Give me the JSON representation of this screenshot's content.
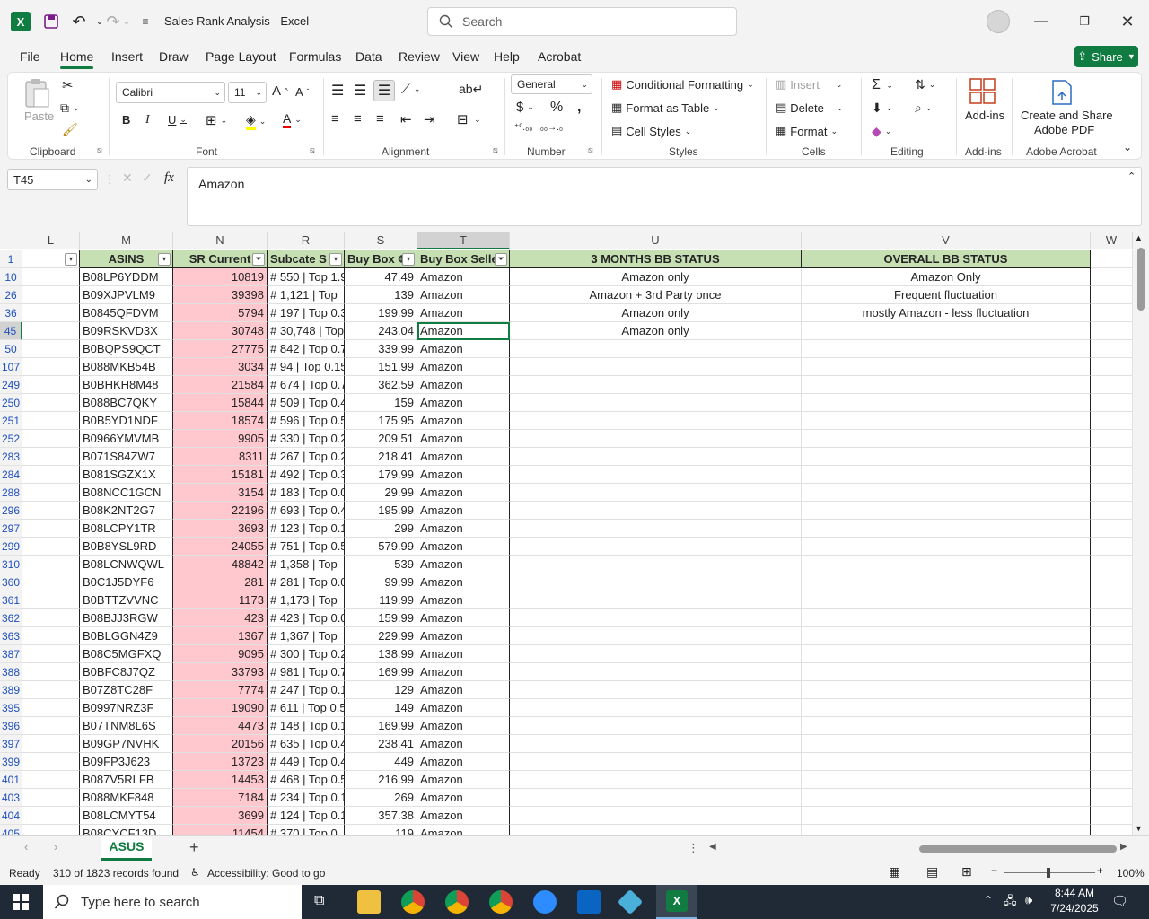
{
  "app": {
    "title": "Sales Rank Analysis  -  Excel",
    "search_placeholder": "Search"
  },
  "menu": [
    "File",
    "Home",
    "Insert",
    "Draw",
    "Page Layout",
    "Formulas",
    "Data",
    "Review",
    "View",
    "Help",
    "Acrobat"
  ],
  "share_label": "Share",
  "ribbon": {
    "clipboard": {
      "paste": "Paste",
      "label": "Clipboard"
    },
    "font": {
      "name": "Calibri",
      "size": "11",
      "label": "Font"
    },
    "alignment": {
      "label": "Alignment"
    },
    "number": {
      "format": "General",
      "label": "Number"
    },
    "styles": {
      "cond": "Conditional Formatting",
      "table": "Format as Table",
      "cell": "Cell Styles",
      "label": "Styles"
    },
    "cells": {
      "insert": "Insert",
      "delete": "Delete",
      "format": "Format",
      "label": "Cells"
    },
    "editing": {
      "label": "Editing"
    },
    "addins": {
      "btn": "Add-ins",
      "label": "Add-ins"
    },
    "acrobat": {
      "btn1": "Create and Share",
      "btn2": "Adobe PDF",
      "label": "Adobe Acrobat"
    }
  },
  "formula": {
    "namebox": "T45",
    "fx": "fx",
    "value": "Amazon"
  },
  "columns": [
    "L",
    "M",
    "N",
    "R",
    "S",
    "T",
    "U",
    "V",
    "W"
  ],
  "headers": {
    "asins": "ASINS",
    "sr_current": "SR Current",
    "subcate": "Subcate S",
    "buybox": "Buy Box ¢",
    "buybox_seller": "Buy Box Selle",
    "three_months": "3 MONTHS BB STATUS",
    "overall": "OVERALL BB STATUS"
  },
  "rows": [
    {
      "r": "1"
    },
    {
      "r": "10",
      "asin": "B08LP6YDDM",
      "sr": "10819",
      "sub": "# 550 | Top 1.9",
      "bb": "47.49",
      "seller": "Amazon",
      "u": "Amazon only",
      "v": "Amazon Only"
    },
    {
      "r": "26",
      "asin": "B09XJPVLM9",
      "sr": "39398",
      "sub": "# 1,121 | Top",
      "bb": "139",
      "seller": "Amazon",
      "u": "Amazon + 3rd Party once",
      "v": "Frequent fluctuation"
    },
    {
      "r": "36",
      "asin": "B0845QFDVM",
      "sr": "5794",
      "sub": "# 197 | Top 0.3",
      "bb": "199.99",
      "seller": "Amazon",
      "u": "Amazon only",
      "v": "mostly Amazon - less fluctuation"
    },
    {
      "r": "45",
      "asin": "B09RSKVD3X",
      "sr": "30748",
      "sub": "# 30,748 | Top",
      "bb": "243.04",
      "seller": "Amazon",
      "u": "Amazon only",
      "v": ""
    },
    {
      "r": "50",
      "asin": "B0BQPS9QCT",
      "sr": "27775",
      "sub": "# 842 | Top 0.7",
      "bb": "339.99",
      "seller": "Amazon"
    },
    {
      "r": "107",
      "asin": "B088MKB54B",
      "sr": "3034",
      "sub": "# 94 | Top 0.15",
      "bb": "151.99",
      "seller": "Amazon"
    },
    {
      "r": "249",
      "asin": "B0BHKH8M48",
      "sr": "21584",
      "sub": "# 674 | Top 0.7",
      "bb": "362.59",
      "seller": "Amazon"
    },
    {
      "r": "250",
      "asin": "B088BC7QKY",
      "sr": "15844",
      "sub": "# 509 | Top 0.4",
      "bb": "159",
      "seller": "Amazon"
    },
    {
      "r": "251",
      "asin": "B0B5YD1NDF",
      "sr": "18574",
      "sub": "# 596 | Top 0.5",
      "bb": "175.95",
      "seller": "Amazon"
    },
    {
      "r": "252",
      "asin": "B0966YMVMB",
      "sr": "9905",
      "sub": "# 330 | Top 0.2",
      "bb": "209.51",
      "seller": "Amazon"
    },
    {
      "r": "283",
      "asin": "B071S84ZW7",
      "sr": "8311",
      "sub": "# 267 | Top 0.2",
      "bb": "218.41",
      "seller": "Amazon"
    },
    {
      "r": "284",
      "asin": "B081SGZX1X",
      "sr": "15181",
      "sub": "# 492 | Top 0.3",
      "bb": "179.99",
      "seller": "Amazon"
    },
    {
      "r": "288",
      "asin": "B08NCC1GCN",
      "sr": "3154",
      "sub": "# 183 | Top 0.0",
      "bb": "29.99",
      "seller": "Amazon"
    },
    {
      "r": "296",
      "asin": "B08K2NT2G7",
      "sr": "22196",
      "sub": "# 693 | Top 0.4",
      "bb": "195.99",
      "seller": "Amazon"
    },
    {
      "r": "297",
      "asin": "B08LCPY1TR",
      "sr": "3693",
      "sub": "# 123 | Top 0.1",
      "bb": "299",
      "seller": "Amazon"
    },
    {
      "r": "299",
      "asin": "B0B8YSL9RD",
      "sr": "24055",
      "sub": "# 751 | Top 0.5",
      "bb": "579.99",
      "seller": "Amazon"
    },
    {
      "r": "310",
      "asin": "B08LCNWQWL",
      "sr": "48842",
      "sub": "# 1,358 | Top",
      "bb": "539",
      "seller": "Amazon"
    },
    {
      "r": "360",
      "asin": "B0C1J5DYF6",
      "sr": "281",
      "sub": "# 281 | Top 0.0",
      "bb": "99.99",
      "seller": "Amazon"
    },
    {
      "r": "361",
      "asin": "B0BTTZVVNC",
      "sr": "1173",
      "sub": "# 1,173 | Top",
      "bb": "119.99",
      "seller": "Amazon"
    },
    {
      "r": "362",
      "asin": "B08BJJ3RGW",
      "sr": "423",
      "sub": "# 423 | Top 0.0",
      "bb": "159.99",
      "seller": "Amazon"
    },
    {
      "r": "363",
      "asin": "B0BLGGN4Z9",
      "sr": "1367",
      "sub": "# 1,367 | Top",
      "bb": "229.99",
      "seller": "Amazon"
    },
    {
      "r": "387",
      "asin": "B08C5MGFXQ",
      "sr": "9095",
      "sub": "# 300 | Top 0.2",
      "bb": "138.99",
      "seller": "Amazon"
    },
    {
      "r": "388",
      "asin": "B0BFC8J7QZ",
      "sr": "33793",
      "sub": "# 981 | Top 0.7",
      "bb": "169.99",
      "seller": "Amazon"
    },
    {
      "r": "389",
      "asin": "B07Z8TC28F",
      "sr": "7774",
      "sub": "# 247 | Top 0.1",
      "bb": "129",
      "seller": "Amazon"
    },
    {
      "r": "395",
      "asin": "B0997NRZ3F",
      "sr": "19090",
      "sub": "# 611 | Top 0.5",
      "bb": "149",
      "seller": "Amazon"
    },
    {
      "r": "396",
      "asin": "B07TNM8L6S",
      "sr": "4473",
      "sub": "# 148 | Top 0.1",
      "bb": "169.99",
      "seller": "Amazon"
    },
    {
      "r": "397",
      "asin": "B09GP7NVHK",
      "sr": "20156",
      "sub": "# 635 | Top 0.4",
      "bb": "238.41",
      "seller": "Amazon"
    },
    {
      "r": "399",
      "asin": "B09FP3J623",
      "sr": "13723",
      "sub": "# 449 | Top 0.4",
      "bb": "449",
      "seller": "Amazon"
    },
    {
      "r": "401",
      "asin": "B087V5RLFB",
      "sr": "14453",
      "sub": "# 468 | Top 0.5",
      "bb": "216.99",
      "seller": "Amazon"
    },
    {
      "r": "403",
      "asin": "B088MKF848",
      "sr": "7184",
      "sub": "# 234 | Top 0.1",
      "bb": "269",
      "seller": "Amazon"
    },
    {
      "r": "404",
      "asin": "B08LCMYT54",
      "sr": "3699",
      "sub": "# 124 | Top 0.1",
      "bb": "357.38",
      "seller": "Amazon"
    },
    {
      "r": "405",
      "asin": "B08CYCF13D",
      "sr": "11454",
      "sub": "# 370 | Top 0.",
      "bb": "119",
      "seller": "Amazon"
    }
  ],
  "sheet": {
    "tab": "ASUS"
  },
  "status": {
    "ready": "Ready",
    "records": "310 of 1823 records found",
    "accessibility": "Accessibility: Good to go",
    "zoom": "100%"
  },
  "taskbar": {
    "search": "Type here to search",
    "time": "8:44 AM",
    "date": "7/24/2025"
  }
}
